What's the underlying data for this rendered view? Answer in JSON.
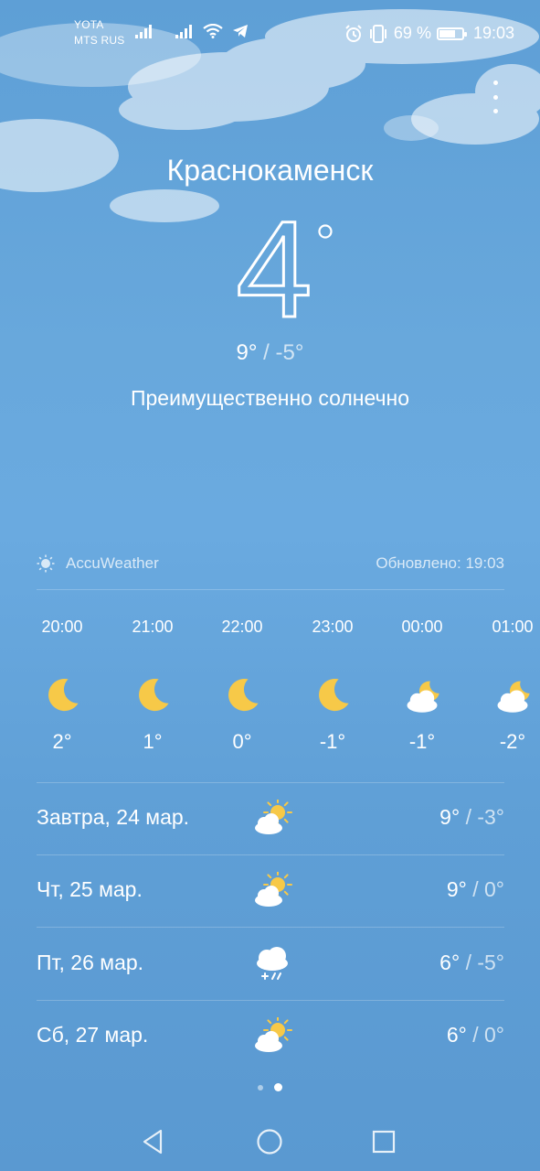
{
  "status_bar": {
    "carrier_1": "YOTA",
    "carrier_2": "MTS RUS",
    "battery_percent_text": "69 %",
    "battery_level": 0.69,
    "time": "19:03",
    "icons": [
      "signal-icon",
      "signal-icon",
      "wifi-icon",
      "telegram-icon",
      "alarm-icon",
      "vibrate-icon",
      "battery-icon"
    ]
  },
  "current": {
    "city": "Краснокаменск",
    "temperature": "4",
    "high": "9°",
    "separator": "/",
    "low": "-5°",
    "condition": "Преимущественно солнечно"
  },
  "source": {
    "provider": "AccuWeather",
    "updated": "Обновлено: 19:03"
  },
  "hourly": [
    {
      "time": "20:00",
      "icon": "moon-icon",
      "temp": "2°"
    },
    {
      "time": "21:00",
      "icon": "moon-icon",
      "temp": "1°"
    },
    {
      "time": "22:00",
      "icon": "moon-icon",
      "temp": "0°"
    },
    {
      "time": "23:00",
      "icon": "moon-icon",
      "temp": "-1°"
    },
    {
      "time": "00:00",
      "icon": "cloudy-night-icon",
      "temp": "-1°"
    },
    {
      "time": "01:00",
      "icon": "cloudy-night-icon",
      "temp": "-2°"
    }
  ],
  "daily": [
    {
      "name": "Завтра, 24 мар.",
      "icon": "partly-sunny-icon",
      "high": "9°",
      "low": "-3°"
    },
    {
      "name": "Чт, 25 мар.",
      "icon": "partly-sunny-icon",
      "high": "9°",
      "low": "0°"
    },
    {
      "name": "Пт, 26 мар.",
      "icon": "snow-cloud-icon",
      "high": "6°",
      "low": "-5°"
    },
    {
      "name": "Сб, 27 мар.",
      "icon": "partly-sunny-icon",
      "high": "6°",
      "low": "0°"
    }
  ],
  "colors": {
    "background_top": "#5e9fd6",
    "background_bottom": "#5a99d1",
    "moon": "#f7c948",
    "sun": "#f7c948",
    "cloud": "#ffffff"
  }
}
